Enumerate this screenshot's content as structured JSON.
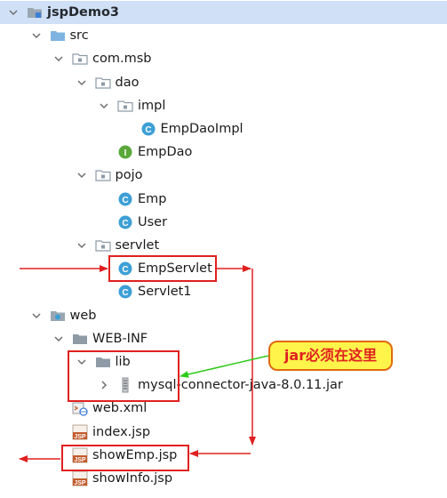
{
  "tree": [
    {
      "label": "jspDemo3",
      "icon": "module-folder-icon",
      "expanded": true
    },
    {
      "label": "src",
      "icon": "source-folder-icon",
      "expanded": true
    },
    {
      "label": "com.msb",
      "icon": "package-icon",
      "expanded": true
    },
    {
      "label": "dao",
      "icon": "package-icon",
      "expanded": true
    },
    {
      "label": "impl",
      "icon": "package-icon",
      "expanded": true
    },
    {
      "label": "EmpDaoImpl",
      "icon": "class-icon",
      "badge": "C"
    },
    {
      "label": "EmpDao",
      "icon": "interface-icon",
      "badge": "I"
    },
    {
      "label": "pojo",
      "icon": "package-icon",
      "expanded": true
    },
    {
      "label": "Emp",
      "icon": "class-icon",
      "badge": "C"
    },
    {
      "label": "User",
      "icon": "class-icon",
      "badge": "C"
    },
    {
      "label": "servlet",
      "icon": "package-icon",
      "expanded": true
    },
    {
      "label": "EmpServlet",
      "icon": "class-icon",
      "badge": "C"
    },
    {
      "label": "Servlet1",
      "icon": "class-icon",
      "badge": "C"
    },
    {
      "label": "web",
      "icon": "web-folder-icon",
      "expanded": true
    },
    {
      "label": "WEB-INF",
      "icon": "folder-icon",
      "expanded": true
    },
    {
      "label": "lib",
      "icon": "folder-icon",
      "expanded": true
    },
    {
      "label": "mysql-connector-java-8.0.11.jar",
      "icon": "jar-icon",
      "expanded": false
    },
    {
      "label": "web.xml",
      "icon": "web-xml-icon"
    },
    {
      "label": "index.jsp",
      "icon": "jsp-file-icon",
      "badge": "JSP"
    },
    {
      "label": "showEmp.jsp",
      "icon": "jsp-file-icon",
      "badge": "JSP"
    },
    {
      "label": "showInfo.jsp",
      "icon": "jsp-file-icon",
      "badge": "JSP"
    }
  ],
  "annotation": {
    "callout_text": "jar必须在这里",
    "callout_fill": "#fff44a",
    "callout_border": "#e06a10",
    "callout_text_color": "#e02020",
    "highlight_color": "#e02020",
    "arrow_red": "#e02020",
    "arrow_green": "#2ecc1a"
  },
  "colors": {
    "selection": "#cfe0f7",
    "class_badge": "#3d9fd6",
    "interface_badge": "#5aa83a",
    "folder": "#8e9aa6",
    "jsp": "#c35b2c"
  }
}
